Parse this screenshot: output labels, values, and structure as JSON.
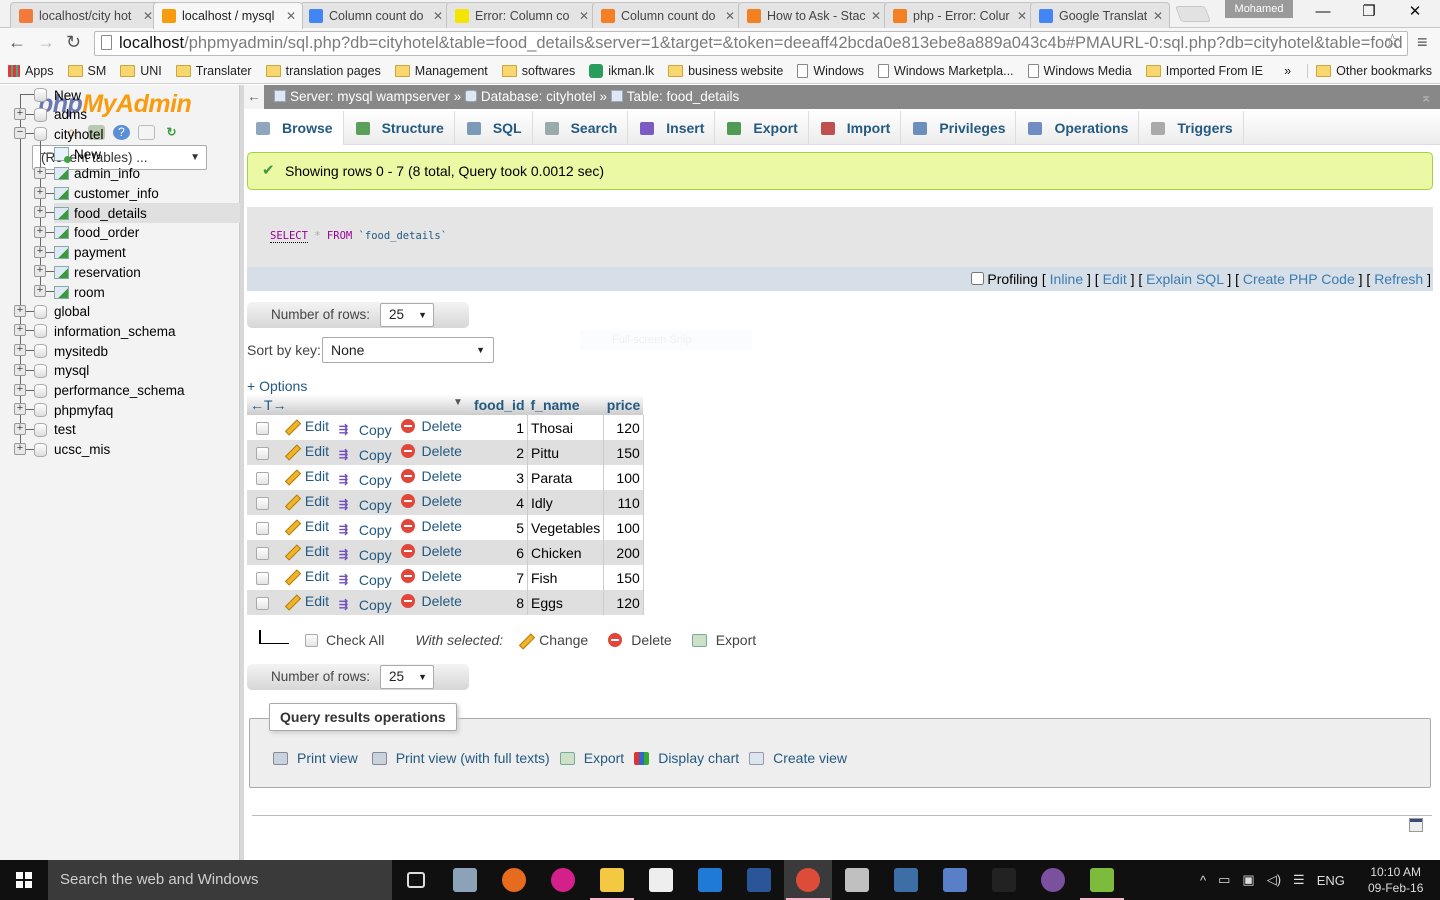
{
  "browser": {
    "tabs": [
      {
        "title": "localhost/city hot",
        "icon": "xampp-icon",
        "color": "#f37a3b",
        "active": false
      },
      {
        "title": "localhost / mysql",
        "icon": "phpmyadmin-icon",
        "color": "#f89c0e",
        "active": true
      },
      {
        "title": "Column count do",
        "icon": "google-icon",
        "color": "#4285f4",
        "active": false
      },
      {
        "title": "Error: Column co",
        "icon": "wd-icon",
        "color": "#f3e500",
        "active": false
      },
      {
        "title": "Column count do",
        "icon": "stackoverflow-icon",
        "color": "#f48024",
        "active": false
      },
      {
        "title": "How to Ask - Stac",
        "icon": "stackoverflow-icon",
        "color": "#f48024",
        "active": false
      },
      {
        "title": "php - Error: Colur",
        "icon": "stackoverflow-icon",
        "color": "#f48024",
        "active": false
      },
      {
        "title": "Google Translate",
        "icon": "google-translate-icon",
        "color": "#4285f4",
        "active": false
      }
    ],
    "profile": "Mohamed",
    "window_controls": {
      "minimize": "—",
      "restore": "❐",
      "close": "✕"
    },
    "url_host": "localhost",
    "url_rest": "/phpmyadmin/sql.php?db=cityhotel&table=food_details&server=1&target=&token=deeaff42bcda0e813ebe8a889a043c4b#PMAURL-0:sql.php?db=cityhotel&table=food",
    "bookmarks": [
      {
        "label": "Apps",
        "type": "apps"
      },
      {
        "label": "SM",
        "type": "folder"
      },
      {
        "label": "UNI",
        "type": "folder"
      },
      {
        "label": "Translater",
        "type": "folder"
      },
      {
        "label": "translation pages",
        "type": "folder"
      },
      {
        "label": "Management",
        "type": "folder"
      },
      {
        "label": "softwares",
        "type": "folder"
      },
      {
        "label": "ikman.lk",
        "type": "site"
      },
      {
        "label": "business website",
        "type": "folder"
      },
      {
        "label": "Windows",
        "type": "page"
      },
      {
        "label": "Windows Marketpla...",
        "type": "page"
      },
      {
        "label": "Windows Media",
        "type": "page"
      },
      {
        "label": "Imported From IE",
        "type": "folder"
      }
    ],
    "bookmarks_overflow": "»",
    "other_bookmarks": "Other bookmarks"
  },
  "sidebar": {
    "logo_php": "php",
    "logo_myadmin": "MyAdmin",
    "recent_tables": "(Recent tables) ...",
    "tree": [
      {
        "label": "New",
        "level": 0,
        "kind": "new-db"
      },
      {
        "label": "adms",
        "level": 0,
        "kind": "db",
        "expander": "+"
      },
      {
        "label": "cityhotel",
        "level": 0,
        "kind": "db",
        "expander": "−"
      },
      {
        "label": "New",
        "level": 1,
        "kind": "new-table"
      },
      {
        "label": "admin_info",
        "level": 1,
        "kind": "table",
        "expander": "+"
      },
      {
        "label": "customer_info",
        "level": 1,
        "kind": "table",
        "expander": "+"
      },
      {
        "label": "food_details",
        "level": 1,
        "kind": "table",
        "expander": "+",
        "selected": true
      },
      {
        "label": "food_order",
        "level": 1,
        "kind": "table",
        "expander": "+"
      },
      {
        "label": "payment",
        "level": 1,
        "kind": "table",
        "expander": "+"
      },
      {
        "label": "reservation",
        "level": 1,
        "kind": "table",
        "expander": "+"
      },
      {
        "label": "room",
        "level": 1,
        "kind": "table",
        "expander": "+"
      },
      {
        "label": "global",
        "level": 0,
        "kind": "db",
        "expander": "+"
      },
      {
        "label": "information_schema",
        "level": 0,
        "kind": "db",
        "expander": "+"
      },
      {
        "label": "mysitedb",
        "level": 0,
        "kind": "db",
        "expander": "+"
      },
      {
        "label": "mysql",
        "level": 0,
        "kind": "db",
        "expander": "+"
      },
      {
        "label": "performance_schema",
        "level": 0,
        "kind": "db",
        "expander": "+"
      },
      {
        "label": "phpmyfaq",
        "level": 0,
        "kind": "db",
        "expander": "+"
      },
      {
        "label": "test",
        "level": 0,
        "kind": "db",
        "expander": "+"
      },
      {
        "label": "ucsc_mis",
        "level": 0,
        "kind": "db",
        "expander": "+"
      }
    ]
  },
  "breadcrumb": {
    "server": "Server: mysql wampserver",
    "sep": "»",
    "database": "Database: cityhotel",
    "table": "Table: food_details"
  },
  "tabs": [
    {
      "label": "Browse",
      "active": true,
      "color": "#8fa6bf"
    },
    {
      "label": "Structure",
      "color": "#5aa05a"
    },
    {
      "label": "SQL",
      "color": "#7d99b8"
    },
    {
      "label": "Search",
      "color": "#9aa"
    },
    {
      "label": "Insert",
      "color": "#7a5bc4"
    },
    {
      "label": "Export",
      "color": "#4f9a55"
    },
    {
      "label": "Import",
      "color": "#c0504d"
    },
    {
      "label": "Privileges",
      "color": "#6c8fbf"
    },
    {
      "label": "Operations",
      "color": "#6f8dc4"
    },
    {
      "label": "Triggers",
      "color": "#aaa"
    }
  ],
  "message": "Showing rows 0 - 7 (8 total, Query took 0.0012 sec)",
  "sql": {
    "kw1": "SELECT",
    "star": "*",
    "kw2": "FROM",
    "table": "`food_details`"
  },
  "sql_links": {
    "profiling": "Profiling",
    "inline": "Inline",
    "edit": "Edit",
    "explain": "Explain SQL",
    "php": "Create PHP Code",
    "refresh": "Refresh"
  },
  "number_of_rows_label": "Number of rows:",
  "number_of_rows_value": "25",
  "sort_label": "Sort by key:",
  "sort_value": "None",
  "snip_overlay": "Full-screen Snip",
  "options_label": "+ Options",
  "table": {
    "columns": [
      "food_id",
      "f_name",
      "price"
    ],
    "action_labels": {
      "edit": "Edit",
      "copy": "Copy",
      "delete": "Delete"
    },
    "rows": [
      {
        "food_id": "1",
        "f_name": "Thosai",
        "price": "120"
      },
      {
        "food_id": "2",
        "f_name": "Pittu",
        "price": "150"
      },
      {
        "food_id": "3",
        "f_name": "Parata",
        "price": "100"
      },
      {
        "food_id": "4",
        "f_name": "Idly",
        "price": "110"
      },
      {
        "food_id": "5",
        "f_name": "Vegetables",
        "price": "100"
      },
      {
        "food_id": "6",
        "f_name": "Chicken",
        "price": "200"
      },
      {
        "food_id": "7",
        "f_name": "Fish",
        "price": "150"
      },
      {
        "food_id": "8",
        "f_name": "Eggs",
        "price": "120"
      }
    ]
  },
  "bulk": {
    "check_all": "Check All",
    "with_selected": "With selected:",
    "change": "Change",
    "delete": "Delete",
    "export": "Export"
  },
  "query_ops": {
    "legend": "Query results operations",
    "links": [
      "Print view",
      "Print view (with full texts)",
      "Export",
      "Display chart",
      "Create view"
    ]
  },
  "taskbar": {
    "search_placeholder": "Search the web and Windows",
    "apps": [
      {
        "name": "task-view",
        "color": "#101010"
      },
      {
        "name": "resource-monitor",
        "color": "#8aa3b8"
      },
      {
        "name": "firefox",
        "color": "#e66b1f"
      },
      {
        "name": "app-m",
        "color": "#d4208a"
      },
      {
        "name": "file-explorer",
        "color": "#f5c842",
        "underline": true
      },
      {
        "name": "store",
        "color": "#eee"
      },
      {
        "name": "edge",
        "color": "#1f7ad6"
      },
      {
        "name": "word",
        "color": "#2a5699"
      },
      {
        "name": "chrome",
        "color": "#dd4b39",
        "active": true
      },
      {
        "name": "snipping-tool",
        "color": "#c0c0c0"
      },
      {
        "name": "virtualbox",
        "color": "#3d6fa6"
      },
      {
        "name": "network-app",
        "color": "#5a7fc9"
      },
      {
        "name": "command-prompt",
        "color": "#222"
      },
      {
        "name": "viber",
        "color": "#7b519d"
      },
      {
        "name": "notepad-plus",
        "color": "#7dbb3c",
        "underline": true
      }
    ],
    "tray": {
      "chevron": "^",
      "lang": "ENG"
    },
    "time": "10:10 AM",
    "date": "09-Feb-16"
  }
}
